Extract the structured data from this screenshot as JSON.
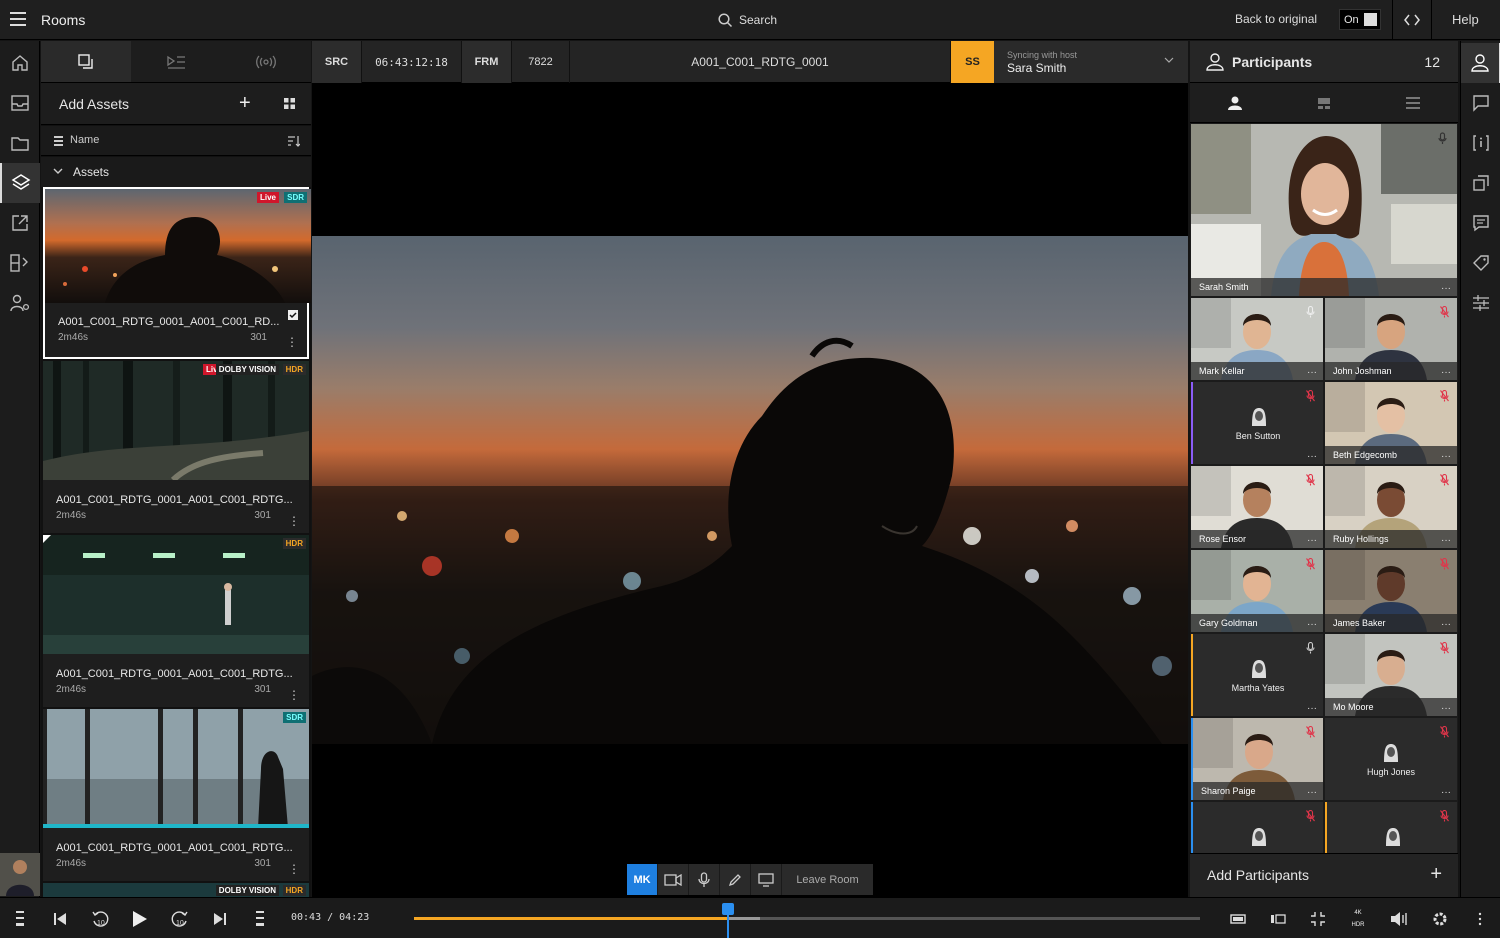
{
  "topbar": {
    "title": "Rooms",
    "search_label": "Search",
    "back_label": "Back to original",
    "toggle_label": "On",
    "help_label": "Help"
  },
  "assets": {
    "add_label": "Add Assets",
    "sort_label": "Name",
    "group_label": "Assets",
    "items": [
      {
        "name": "A001_C001_RDTG_0001_A001_C001_RD...",
        "duration": "2m46s",
        "count": "301",
        "badges": [
          "Live",
          "SDR"
        ],
        "selected": true
      },
      {
        "name": "A001_C001_RDTG_0001_A001_C001_RDTG...",
        "duration": "2m46s",
        "count": "301",
        "badges": [
          "Live",
          "DOLBY VISION",
          "HDR"
        ]
      },
      {
        "name": "A001_C001_RDTG_0001_A001_C001_RDTG...",
        "duration": "2m46s",
        "count": "301",
        "badges": [
          "HDR"
        ]
      },
      {
        "name": "A001_C001_RDTG_0001_A001_C001_RDTG...",
        "duration": "2m46s",
        "count": "301",
        "badges": [
          "SDR"
        ]
      }
    ],
    "partial_badges": [
      "DOLBY VISION",
      "HDR"
    ]
  },
  "viewer": {
    "src_label": "SRC",
    "src_tc": "06:43:12:18",
    "frm_label": "FRM",
    "frm_value": "7822",
    "clip_name": "A001_C001_RDTG_0001",
    "host_initials": "SS",
    "sync_label": "Syncing with host",
    "host_name": "Sara Smith"
  },
  "controls": {
    "initials": "MK",
    "leave_label": "Leave Room"
  },
  "participants": {
    "title": "Participants",
    "count": "12",
    "main": {
      "name": "Sarah Smith"
    },
    "tiles": [
      {
        "name": "Mark Kellar"
      },
      {
        "name": "John Joshman"
      },
      {
        "name": "Ben Sutton"
      },
      {
        "name": "Beth Edgecomb"
      },
      {
        "name": "Rose Ensor"
      },
      {
        "name": "Ruby Hollings"
      },
      {
        "name": "Gary Goldman"
      },
      {
        "name": "James Baker"
      },
      {
        "name": "Martha Yates"
      },
      {
        "name": "Mo Moore"
      },
      {
        "name": "Sharon Paige"
      },
      {
        "name": "Hugh Jones"
      }
    ],
    "add_label": "Add Participants"
  },
  "transport": {
    "timecode": "00:43 / 04:23",
    "progress": 0.4,
    "buffer_end": 0.44,
    "quality_top": "4K",
    "quality_bottom": "HDR"
  },
  "colors": {
    "accent_orange": "#f5a623",
    "accent_blue": "#1e7fe0",
    "live_red": "#d0162b"
  }
}
